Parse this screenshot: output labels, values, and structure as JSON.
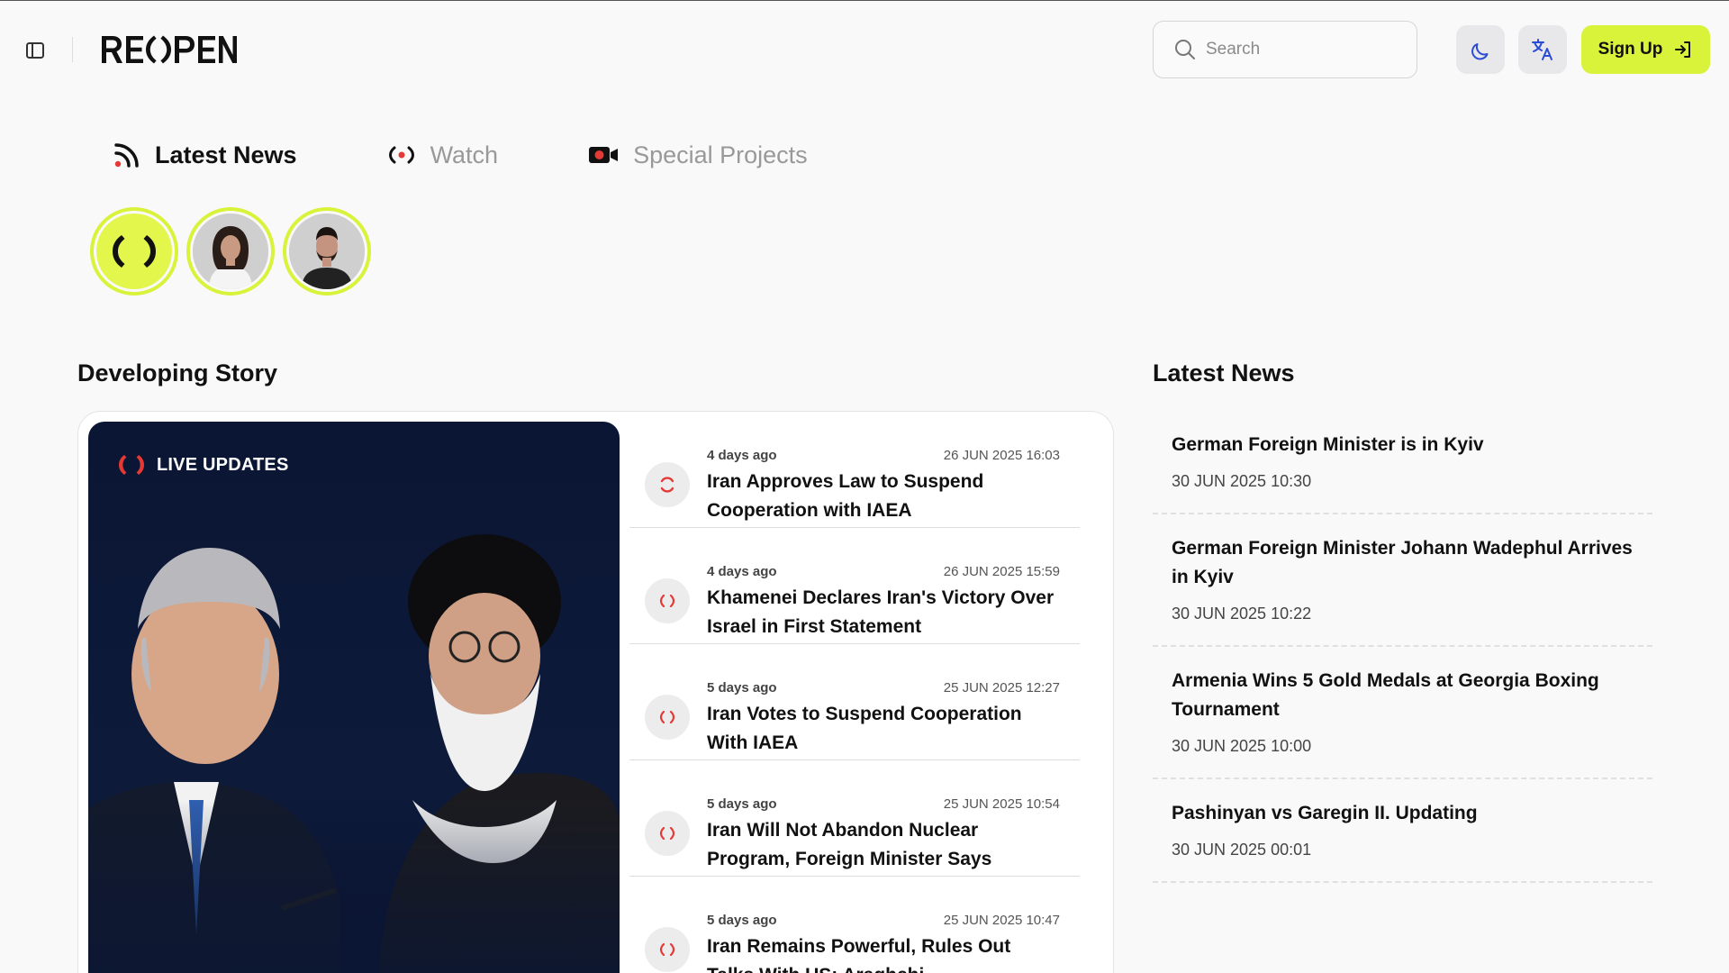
{
  "header": {
    "logo_text": "REOPEN",
    "search_placeholder": "Search",
    "signup_label": "Sign Up"
  },
  "colors": {
    "accent": "#d9f23a",
    "live_red": "#e53935",
    "background": "#f9f9f9"
  },
  "tabs": [
    {
      "label": "Latest News",
      "icon": "rss-icon",
      "active": true
    },
    {
      "label": "Watch",
      "icon": "live-broadcast-icon",
      "active": false
    },
    {
      "label": "Special Projects",
      "icon": "video-camera-icon",
      "active": false
    }
  ],
  "developing": {
    "title": "Developing Story",
    "live_label": "LIVE UPDATES",
    "items": [
      {
        "ago": "4 days ago",
        "date": "26 JUN 2025 16:03",
        "headline": "Iran Approves Law to Suspend Cooperation with IAEA"
      },
      {
        "ago": "4 days ago",
        "date": "26 JUN 2025 15:59",
        "headline": "Khamenei Declares Iran's Victory Over Israel in First Statement"
      },
      {
        "ago": "5 days ago",
        "date": "25 JUN 2025 12:27",
        "headline": "Iran Votes to Suspend Cooperation With IAEA"
      },
      {
        "ago": "5 days ago",
        "date": "25 JUN 2025 10:54",
        "headline": "Iran Will Not Abandon Nuclear Program, Foreign Minister Says"
      },
      {
        "ago": "5 days ago",
        "date": "25 JUN 2025 10:47",
        "headline": "Iran Remains Powerful, Rules Out Talks With US: Araghchi"
      }
    ]
  },
  "latest": {
    "title": "Latest News",
    "items": [
      {
        "title": "German Foreign Minister is in Kyiv",
        "time": "30 JUN 2025 10:30"
      },
      {
        "title": "German Foreign Minister Johann Wadephul Arrives in Kyiv",
        "time": "30 JUN 2025 10:22"
      },
      {
        "title": "Armenia Wins 5 Gold Medals at Georgia Boxing Tournament",
        "time": "30 JUN 2025 10:00"
      },
      {
        "title": "Pashinyan vs Garegin II. Updating",
        "time": "30 JUN 2025 00:01"
      }
    ]
  }
}
